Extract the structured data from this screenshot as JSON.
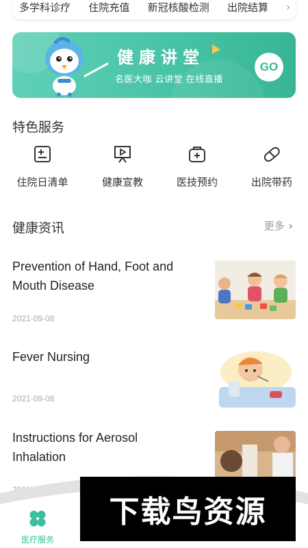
{
  "top_links": [
    "多学科诊疗",
    "住院充值",
    "新冠核酸检测",
    "出院结算"
  ],
  "banner": {
    "title": "健康讲堂",
    "subtitle": "名医大咖 云讲堂 在线直播",
    "go_label": "GO",
    "accent": "#45c2a4"
  },
  "services": {
    "title": "特色服务",
    "items": [
      {
        "label": "住院日清单",
        "icon": "list-plus-icon"
      },
      {
        "label": "健康宣教",
        "icon": "presentation-icon"
      },
      {
        "label": "医技预约",
        "icon": "medical-kit-icon"
      },
      {
        "label": "出院带药",
        "icon": "pill-icon"
      }
    ]
  },
  "news": {
    "title": "健康资讯",
    "more_label": "更多",
    "items": [
      {
        "title": "Prevention of Hand, Foot and Mouth Disease",
        "date": "2021-09-08",
        "image": "children-playing-image"
      },
      {
        "title": "Fever Nursing",
        "date": "2021-09-08",
        "image": "sick-child-cartoon-image"
      },
      {
        "title": "Instructions for Aerosol Inhalation",
        "date": "2021-09-08",
        "image": "aerosol-inhalation-image"
      }
    ]
  },
  "bottom_nav": {
    "items": [
      {
        "label": "医疗服务",
        "active": true
      }
    ]
  },
  "watermark": {
    "text": "下载鸟资源"
  },
  "colors": {
    "primary": "#3bbf9c",
    "text": "#222222",
    "muted": "#aaaaaa"
  }
}
